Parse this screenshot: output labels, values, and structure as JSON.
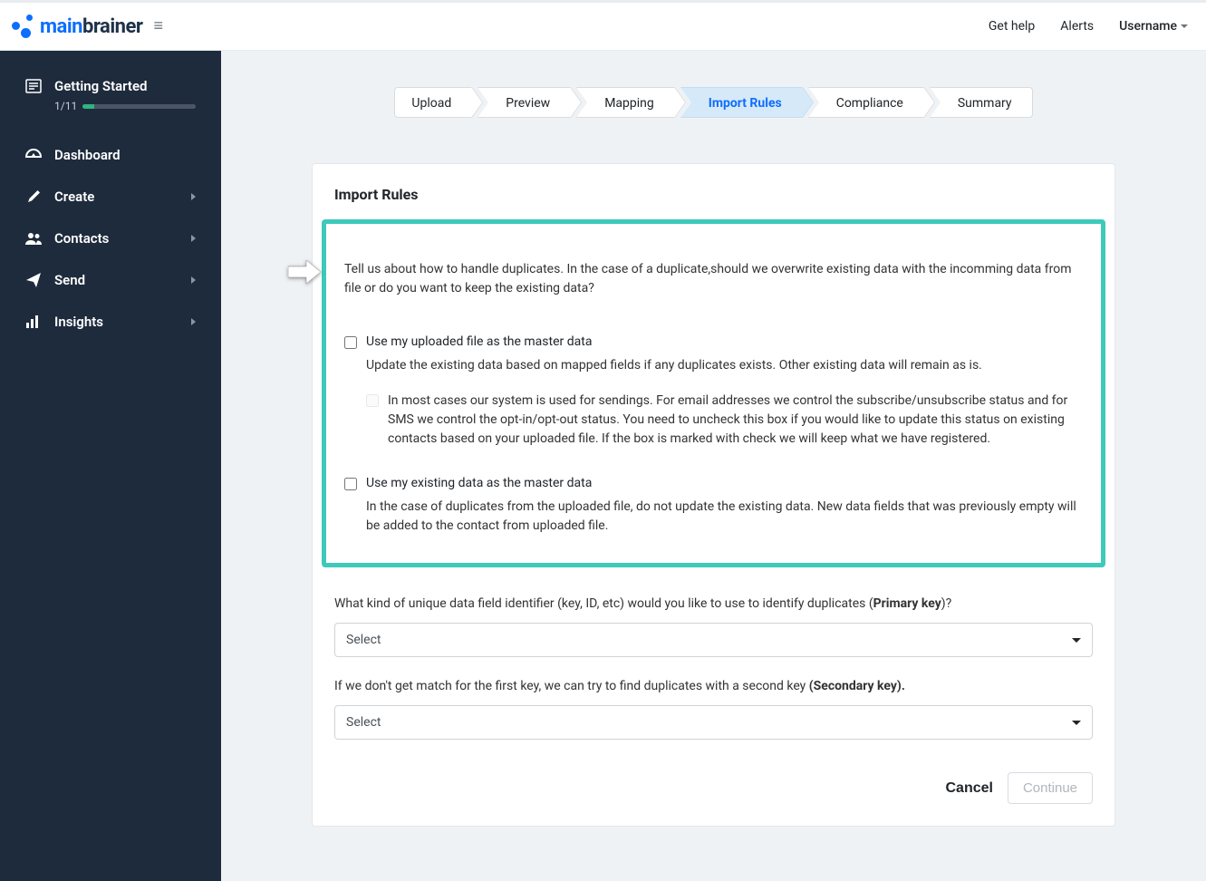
{
  "header": {
    "brand_first": "main",
    "brand_second": "brainer",
    "get_help": "Get help",
    "alerts": "Alerts",
    "username": "Username"
  },
  "sidebar": {
    "getting_started": {
      "title": "Getting Started",
      "progress_label": "1/11"
    },
    "items": [
      {
        "label": "Dashboard",
        "has_sub": false
      },
      {
        "label": "Create",
        "has_sub": true
      },
      {
        "label": "Contacts",
        "has_sub": true
      },
      {
        "label": "Send",
        "has_sub": true
      },
      {
        "label": "Insights",
        "has_sub": true
      }
    ]
  },
  "steps": [
    {
      "label": "Upload",
      "active": false
    },
    {
      "label": "Preview",
      "active": false
    },
    {
      "label": "Mapping",
      "active": false
    },
    {
      "label": "Import Rules",
      "active": true
    },
    {
      "label": "Compliance",
      "active": false
    },
    {
      "label": "Summary",
      "active": false
    }
  ],
  "card": {
    "title": "Import Rules",
    "intro": "Tell us about how to handle duplicates. In the case of a duplicate,should we overwrite existing data with the incomming data from file or do you want to keep the existing data?",
    "option1": {
      "title": "Use my uploaded file as the master data",
      "desc": "Update the existing data based on mapped fields if any duplicates exists. Other existing data will remain as is.",
      "sub": "In most cases our system is used for sendings. For email addresses we control the subscribe/unsubscribe status and for SMS we control the opt-in/opt-out status. You need to uncheck this box if you would like to update this status on existing contacts based on your uploaded file. If the box is marked with check we will keep what we have registered."
    },
    "option2": {
      "title": "Use my existing data as the master data",
      "desc": "In the case of duplicates from the uploaded file, do not update the existing data. New data fields that was previously empty will be added to the contact from uploaded file."
    },
    "primary_key": {
      "label_pre": "What kind of unique data field identifier (key, ID, etc) would you like to use to identify duplicates (",
      "label_bold": "Primary key",
      "label_post": ")?",
      "placeholder": "Select"
    },
    "secondary_key": {
      "label_pre": "If we don't get match for the first key, we can try to find duplicates with a second key ",
      "label_bold": "(Secondary key).",
      "placeholder": "Select"
    },
    "actions": {
      "cancel": "Cancel",
      "continue": "Continue"
    }
  }
}
